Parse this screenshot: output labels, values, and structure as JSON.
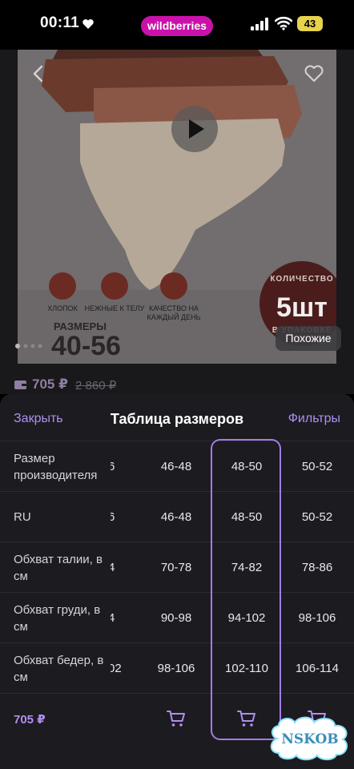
{
  "status_bar": {
    "time": "00:11",
    "app_pill": "wildberries",
    "battery": "43"
  },
  "product": {
    "features": [
      {
        "icon": "cotton-icon",
        "label": "ХЛОПОК"
      },
      {
        "icon": "heart-icon",
        "label": "НЕЖНЫЕ К ТЕЛУ"
      },
      {
        "icon": "shield-check-icon",
        "label": "КАЧЕСТВО НА КАЖДЫЙ ДЕНЬ"
      }
    ],
    "sizes_label": "РАЗМЕРЫ",
    "sizes_value": "40-56",
    "qty_badge": {
      "top": "КОЛИЧЕСТВО",
      "number": "5шт",
      "bottom": "В УПАКОВКЕ"
    },
    "similar_button": "Похожие",
    "price_current": "705 ₽",
    "price_old": "2 860 ₽"
  },
  "sheet": {
    "close_label": "Закрыть",
    "title": "Таблица размеров",
    "filters_label": "Фильтры",
    "rows": [
      {
        "label": "Размер производителя",
        "values": [
          "6",
          "46-48",
          "48-50",
          "50-52"
        ]
      },
      {
        "label": "RU",
        "values": [
          "6",
          "46-48",
          "48-50",
          "50-52"
        ]
      },
      {
        "label": "Обхват талии, в см",
        "values": [
          "4",
          "70-78",
          "74-82",
          "78-86"
        ]
      },
      {
        "label": "Обхват груди, в см",
        "values": [
          "4",
          "90-98",
          "94-102",
          "98-106"
        ]
      },
      {
        "label": "Обхват бедер, в см",
        "values": [
          "02",
          "98-106",
          "102-110",
          "106-114"
        ]
      }
    ],
    "footer_price": "705 ₽",
    "selected_column_index": 2
  },
  "watermark": "NSKOB",
  "colors": {
    "accent": "#b08ef0",
    "brand_pill": "#cb11ab",
    "selected_outline": "#a37be8",
    "sheet_bg": "#1c1b20"
  }
}
